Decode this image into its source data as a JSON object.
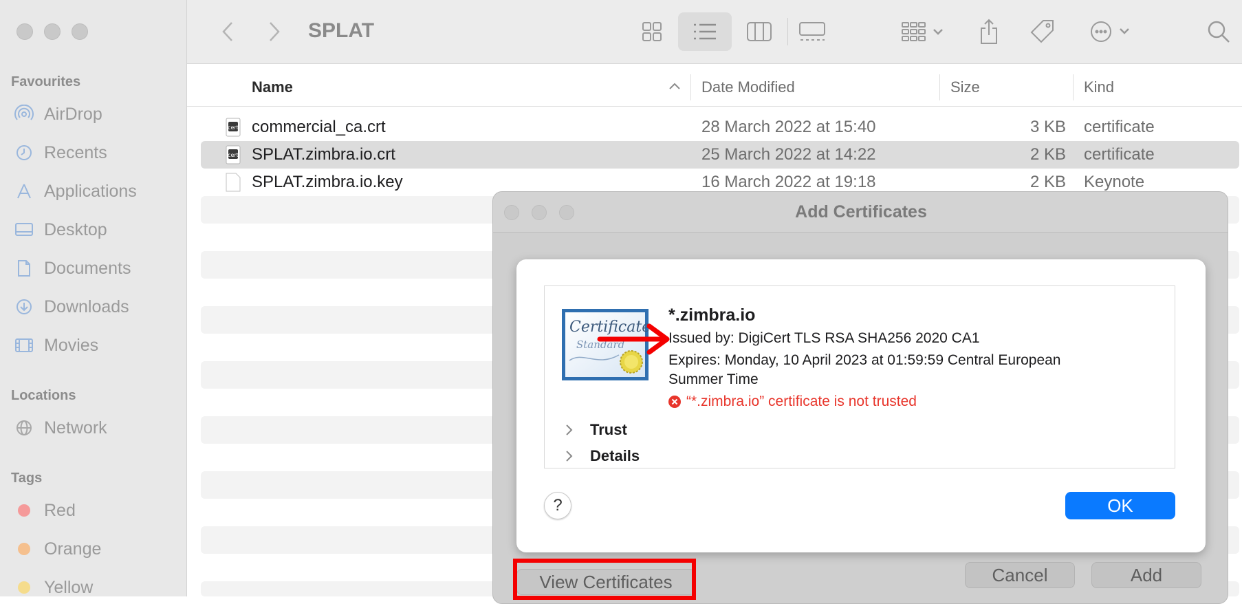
{
  "window": {
    "title": "SPLAT"
  },
  "sidebar": {
    "favourites_heading": "Favourites",
    "favourites": [
      {
        "label": "AirDrop",
        "icon": "airdrop-icon"
      },
      {
        "label": "Recents",
        "icon": "clock-icon"
      },
      {
        "label": "Applications",
        "icon": "applications-icon"
      },
      {
        "label": "Desktop",
        "icon": "desktop-icon"
      },
      {
        "label": "Documents",
        "icon": "document-icon"
      },
      {
        "label": "Downloads",
        "icon": "download-icon"
      },
      {
        "label": "Movies",
        "icon": "film-icon"
      }
    ],
    "locations_heading": "Locations",
    "locations": [
      {
        "label": "Network",
        "icon": "globe-icon"
      }
    ],
    "tags_heading": "Tags",
    "tags": [
      {
        "label": "Red",
        "color": "#f59a9a"
      },
      {
        "label": "Orange",
        "color": "#f5c08e"
      },
      {
        "label": "Yellow",
        "color": "#f5dc8c"
      }
    ]
  },
  "columns": {
    "name": "Name",
    "date": "Date Modified",
    "size": "Size",
    "kind": "Kind"
  },
  "files": [
    {
      "name": "commercial_ca.crt",
      "date": "28 March 2022 at 15:40",
      "size": "3 KB",
      "kind": "certificate",
      "selected": false
    },
    {
      "name": "SPLAT.zimbra.io.crt",
      "date": "25 March 2022 at 14:22",
      "size": "2 KB",
      "kind": "certificate",
      "selected": true
    },
    {
      "name": "SPLAT.zimbra.io.key",
      "date": "16 March 2022 at 19:18",
      "size": "2 KB",
      "kind": "Keynote",
      "selected": false
    }
  ],
  "dialog": {
    "title": "Add Certificates",
    "cert": {
      "badge_text": "Certificate",
      "badge_subtext": "Standard",
      "name": "*.zimbra.io",
      "issued_by": "Issued by: DigiCert TLS RSA SHA256 2020 CA1",
      "expires_line1": "Expires: Monday, 10 April 2023 at 01:59:59 Central European",
      "expires_line2": "Summer Time",
      "warning": "“*.zimbra.io” certificate is not trusted"
    },
    "trust_label": "Trust",
    "details_label": "Details",
    "help_label": "?",
    "ok_label": "OK",
    "view_certificates_label": "View Certificates",
    "cancel_label": "Cancel",
    "add_label": "Add"
  },
  "colors": {
    "accent": "#0a7aff",
    "warning": "#e8352b",
    "annotation": "#f40000"
  }
}
